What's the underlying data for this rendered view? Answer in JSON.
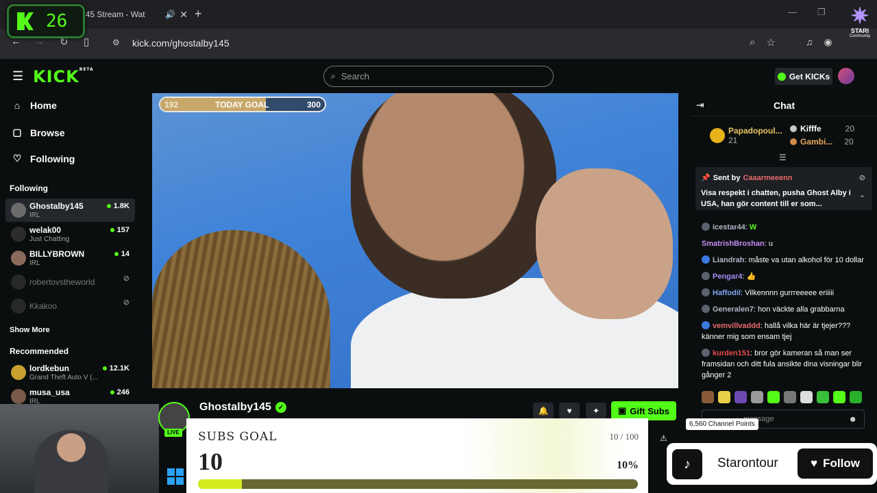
{
  "browser": {
    "tab_title": "145 Stream - Wat",
    "url": "kick.com/ghostalby145"
  },
  "overlay_badge": {
    "count": "26"
  },
  "stari": {
    "label": "STARI",
    "sub": "Community"
  },
  "header": {
    "logo": "KICK",
    "logo_badge": "BETA",
    "search_placeholder": "Search",
    "get_kicks": "Get KICKs"
  },
  "sidebar": {
    "nav": [
      {
        "label": "Home"
      },
      {
        "label": "Browse"
      },
      {
        "label": "Following"
      }
    ],
    "following_title": "Following",
    "following": [
      {
        "name": "Ghostalby145",
        "category": "IRL",
        "viewers": "1.8K"
      },
      {
        "name": "welak00",
        "category": "Just Chatting",
        "viewers": "157"
      },
      {
        "name": "BILLYBROWN",
        "category": "IRL",
        "viewers": "14"
      },
      {
        "name": "robertovstheworld"
      },
      {
        "name": "Kkakoo"
      }
    ],
    "show_more": "Show More",
    "recommended_title": "Recommended",
    "recommended": [
      {
        "name": "lordkebun",
        "category": "Grand Theft Auto V (...",
        "viewers": "12.1K"
      },
      {
        "name": "musa_usa",
        "category": "IRL",
        "viewers": "246"
      }
    ]
  },
  "video": {
    "goal": {
      "current": "192",
      "label": "TODAY GOAL",
      "target": "300",
      "progress": 0.64
    }
  },
  "channel": {
    "name": "Ghostalby145",
    "live": "LIVE",
    "gift_subs": "Gift Subs"
  },
  "subs_goal": {
    "title": "SUBS GOAL",
    "count": "10 / 100",
    "value": "10",
    "percent": "10%",
    "progress": 0.1
  },
  "chat": {
    "title": "Chat",
    "top_gifters": [
      {
        "name": "Papadopoul...",
        "count": "21"
      },
      {
        "name": "Kifffe",
        "count": "20"
      },
      {
        "name": "Gambi...",
        "count": "20"
      }
    ],
    "pinned": {
      "sent_by": "Sent by",
      "user": "Caaarmeeenn",
      "message": "Visa respekt i chatten, pusha Ghost Alby i USA, han gör content till er som..."
    },
    "messages": [
      {
        "user": "icestar44",
        "text": "",
        "color": "#b6b6c8"
      },
      {
        "user": "SmatrishBroshan",
        "text": "u",
        "color": "#c58bf2"
      },
      {
        "user": "Liandrah",
        "text": "måste va utan alkohol för 10 dollar",
        "color": "#b6b6c8"
      },
      {
        "user": "Pengar4",
        "text": "",
        "color": "#a58bf2"
      },
      {
        "user": "Haffodil",
        "text": "Vilkennnn gurrreeeee eriiiii",
        "color": "#7fa8f2"
      },
      {
        "user": "Generalen7",
        "text": "hon väckte alla grabbarna",
        "color": "#b6b6c8"
      },
      {
        "user": "vemvillvaddd",
        "text": "hallå vilka här är tjejer??? känner mig som ensam tjej",
        "color": "#e86a6a"
      },
      {
        "user": "kurden151",
        "text": "bror gör kameran så man ser framsidan och ditt fula ansikte dina visningar blir gånger 2",
        "color": "#e84a4a"
      }
    ],
    "input_placeholder": "message",
    "channel_points": "6,560 Channel Points"
  },
  "tiktok": {
    "name": "Starontour",
    "follow": "Follow"
  }
}
